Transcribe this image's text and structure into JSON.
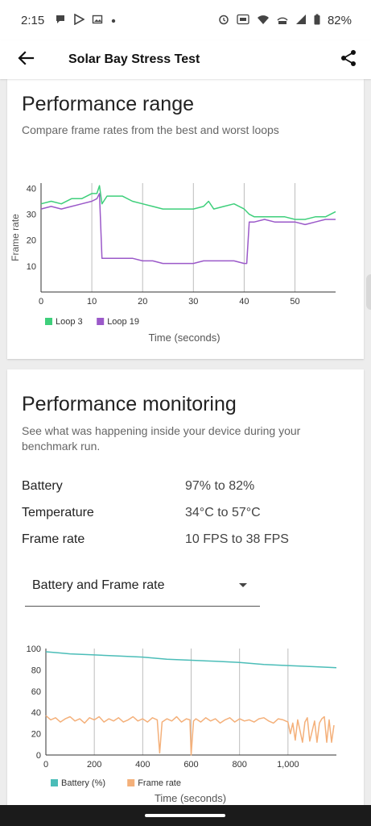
{
  "status_bar": {
    "time": "2:15",
    "battery_percent": "82%",
    "left_icons": [
      "chat-bubble-icon",
      "play-store-icon",
      "gallery-icon",
      "dot-icon"
    ],
    "right_icons": [
      "alarm-icon",
      "hd-voice-icon",
      "wifi-signal-icon",
      "lte-icon",
      "cell-signal-icon",
      "battery-icon"
    ]
  },
  "app_bar": {
    "title": "Solar Bay Stress Test",
    "back_icon": "arrow-back-icon",
    "share_icon": "share-icon"
  },
  "performance_range": {
    "title": "Performance range",
    "subtitle": "Compare frame rates from the best and worst loops"
  },
  "performance_monitoring": {
    "title": "Performance monitoring",
    "subtitle": "See what was happening inside your device during your benchmark run.",
    "rows": [
      {
        "label": "Battery",
        "value": "97% to 82%"
      },
      {
        "label": "Temperature",
        "value": "34°C to 57°C"
      },
      {
        "label": "Frame rate",
        "value": "10 FPS to 38 FPS"
      }
    ],
    "dropdown": {
      "selected": "Battery and Frame rate"
    }
  },
  "colors": {
    "loop3": "#3ecf7b",
    "loop19": "#9b59c9",
    "battery": "#4bbdb8",
    "frame_rate": "#f4b07a",
    "grid": "#bdbdbd",
    "axis": "#333333"
  },
  "chart_data": [
    {
      "type": "line",
      "xlabel": "Time (seconds)",
      "ylabel": "Frame rate",
      "xlim": [
        0,
        58
      ],
      "ylim": [
        0,
        42
      ],
      "xticks": [
        0,
        10,
        20,
        30,
        40,
        50
      ],
      "yticks": [
        10,
        20,
        30,
        40
      ],
      "legend_position": "bottom-left",
      "series": [
        {
          "name": "Loop 3",
          "x": [
            0,
            2,
            4,
            6,
            8,
            10,
            11,
            11.5,
            12,
            13,
            14,
            16,
            18,
            20,
            22,
            24,
            26,
            28,
            30,
            32,
            33,
            34,
            36,
            38,
            40,
            41,
            42,
            44,
            46,
            48,
            50,
            52,
            54,
            56,
            58
          ],
          "y": [
            34,
            35,
            34,
            36,
            36,
            38,
            38,
            41,
            34,
            37,
            37,
            37,
            35,
            34,
            33,
            32,
            32,
            32,
            32,
            33,
            35,
            32,
            33,
            34,
            32,
            30,
            29,
            29,
            29,
            29,
            28,
            28,
            29,
            29,
            31
          ]
        },
        {
          "name": "Loop 19",
          "x": [
            0,
            2,
            4,
            6,
            8,
            10,
            11,
            11.5,
            12,
            14,
            16,
            18,
            20,
            22,
            24,
            26,
            28,
            30,
            32,
            34,
            36,
            38,
            40,
            40.5,
            41,
            42,
            44,
            46,
            48,
            50,
            52,
            54,
            56,
            58
          ],
          "y": [
            32,
            33,
            32,
            33,
            34,
            35,
            36,
            38,
            13,
            13,
            13,
            13,
            12,
            12,
            11,
            11,
            11,
            11,
            12,
            12,
            12,
            12,
            11,
            11,
            27,
            27,
            28,
            27,
            27,
            27,
            26,
            27,
            28,
            28
          ]
        }
      ]
    },
    {
      "type": "line",
      "xlabel": "Time (seconds)",
      "ylabel": "",
      "xlim": [
        0,
        1200
      ],
      "ylim": [
        0,
        100
      ],
      "xticks": [
        0,
        200,
        400,
        600,
        800,
        1000
      ],
      "xtick_labels": [
        "0",
        "200",
        "400",
        "600",
        "800",
        "1,000"
      ],
      "yticks": [
        0,
        20,
        40,
        60,
        80,
        100
      ],
      "legend_position": "bottom-left",
      "series": [
        {
          "name": "Battery (%)",
          "x": [
            0,
            50,
            100,
            200,
            300,
            400,
            500,
            600,
            700,
            800,
            900,
            1000,
            1100,
            1200
          ],
          "y": [
            97,
            96,
            95,
            94,
            93,
            92,
            90,
            89,
            88,
            87,
            85,
            84,
            83,
            82
          ]
        },
        {
          "name": "Frame rate",
          "x": [
            0,
            20,
            40,
            60,
            80,
            100,
            120,
            140,
            160,
            180,
            200,
            220,
            240,
            260,
            280,
            300,
            320,
            340,
            360,
            380,
            400,
            420,
            440,
            460,
            470,
            480,
            500,
            520,
            540,
            560,
            580,
            595,
            600,
            610,
            620,
            640,
            660,
            680,
            700,
            720,
            740,
            760,
            780,
            800,
            820,
            840,
            860,
            880,
            900,
            920,
            940,
            960,
            980,
            1000,
            1010,
            1020,
            1030,
            1040,
            1060,
            1070,
            1080,
            1090,
            1110,
            1120,
            1130,
            1140,
            1150,
            1160,
            1170,
            1180,
            1190
          ],
          "y": [
            37,
            33,
            35,
            31,
            34,
            36,
            32,
            34,
            30,
            35,
            33,
            36,
            31,
            34,
            32,
            35,
            31,
            33,
            36,
            32,
            34,
            31,
            35,
            33,
            2,
            31,
            34,
            32,
            36,
            31,
            34,
            33,
            0,
            32,
            34,
            31,
            35,
            32,
            34,
            30,
            33,
            35,
            31,
            34,
            32,
            33,
            31,
            34,
            35,
            32,
            30,
            34,
            33,
            31,
            20,
            30,
            14,
            33,
            12,
            31,
            35,
            13,
            32,
            12,
            30,
            34,
            36,
            12,
            33,
            12,
            28
          ]
        }
      ]
    }
  ]
}
